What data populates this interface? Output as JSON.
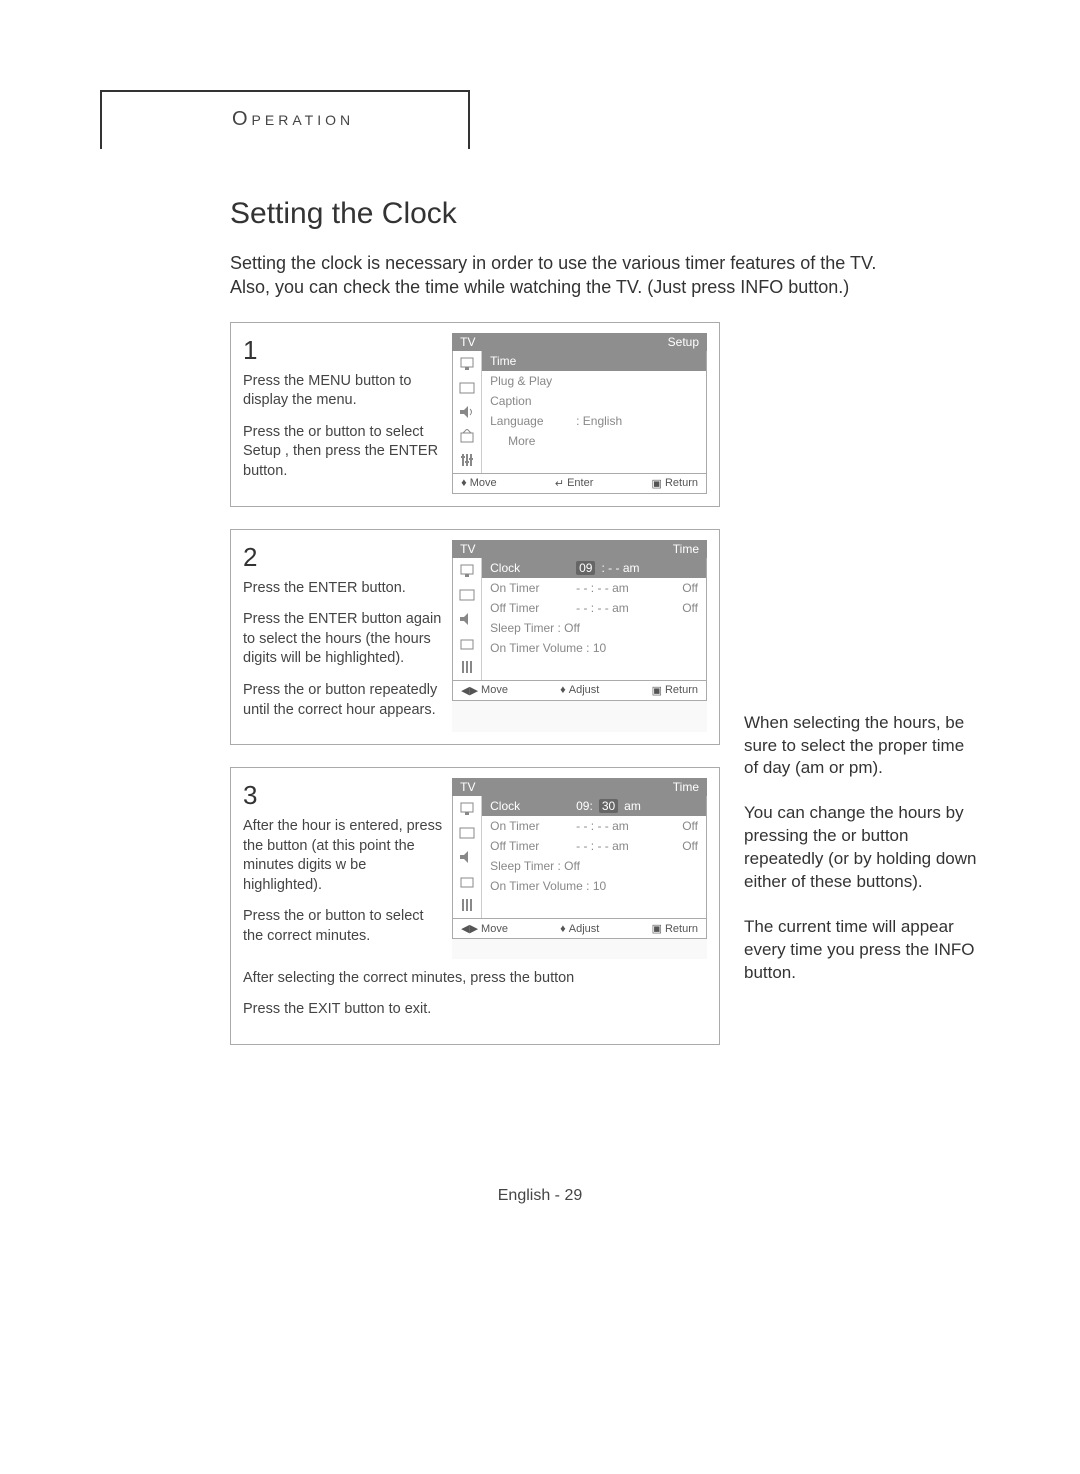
{
  "header": {
    "section": "Operation"
  },
  "title": "Setting the Clock",
  "intro_line1": "Setting the clock is necessary in order to use the various timer features of the TV.",
  "intro_line2_a": "Also, you can check the time while watching the TV. (Just press ",
  "intro_line2_b": "INFO",
  "intro_line2_c": " button.)",
  "step1": {
    "num": "1",
    "p1a": "Press the ",
    "p1b": "MENU",
    "p1c": " button to display the menu.",
    "p2a": "Press the ",
    "p2b": " or ",
    "p2c": " button to select  Setup , then press the ",
    "p2d": "ENTER",
    "p2e": " button."
  },
  "step2": {
    "num": "2",
    "p1a": "Press the ",
    "p1b": "ENTER",
    "p1c": " button.",
    "p2a": "Press the ",
    "p2b": "ENTER",
    "p2c": " button again to select the hours (the hours digits will be highlighted).",
    "p3a": "Press the ",
    "p3b": " or ",
    "p3c": " button repeatedly until the correct hour appears."
  },
  "step3": {
    "num": "3",
    "p1a": "After the hour is entered, press the  button (at this point the minutes digits w be highlighted).",
    "p1b": "Press the ",
    "p1c": " or ",
    "p1d": " button to select the correct minutes.",
    "after1": "After selecting the correct minutes, press the  button",
    "after2a": "Press the ",
    "after2b": "EXIT",
    "after2c": " button to exit."
  },
  "notes": {
    "n1": "When selecting the hours, be sure to select the proper time of day (am or pm).",
    "n2a": "You can change the hours by pressing the ",
    "n2b": " or ",
    "n2c": " button repeatedly (or by holding down either of these buttons).",
    "n3a": "The current time will appear every time you press the ",
    "n3b": "INFO",
    "n3c": " button."
  },
  "osd1": {
    "hdr_left": "TV",
    "hdr_right": "Setup",
    "rows": {
      "time": "Time",
      "plug": "Plug & Play",
      "caption": "Caption",
      "lang_lbl": "Language",
      "lang_val": ":  English",
      "more": "More"
    },
    "foot": {
      "move": "Move",
      "enter": "Enter",
      "ret": "Return"
    }
  },
  "osd2": {
    "hdr_left": "TV",
    "hdr_right": "Time",
    "rows": {
      "clock": "Clock",
      "clock_hr": "09",
      "clock_rest": ": - -  am",
      "on_lbl": "On Timer",
      "on_val": "- - : - -  am",
      "on_state": "Off",
      "off_lbl": "Off Timer",
      "off_val": "- - : - -  am",
      "off_state": "Off",
      "sleep": "Sleep Timer   :  Off",
      "vol": "On Timer Volume  :  10"
    },
    "foot": {
      "move": "Move",
      "adjust": "Adjust",
      "ret": "Return"
    }
  },
  "osd3": {
    "hdr_left": "TV",
    "hdr_right": "Time",
    "rows": {
      "clock": "Clock",
      "clock_hr": "09: ",
      "clock_min": "30",
      "clock_rest": " am",
      "on_lbl": "On Timer",
      "on_val": "- - : - -  am",
      "on_state": "Off",
      "off_lbl": "Off Timer",
      "off_val": "- - : - -  am",
      "off_state": "Off",
      "sleep": "Sleep Timer   :  Off",
      "vol": "On Timer Volume  :  10"
    },
    "foot": {
      "move": "Move",
      "adjust": "Adjust",
      "ret": "Return"
    }
  },
  "footer": "English - 29"
}
